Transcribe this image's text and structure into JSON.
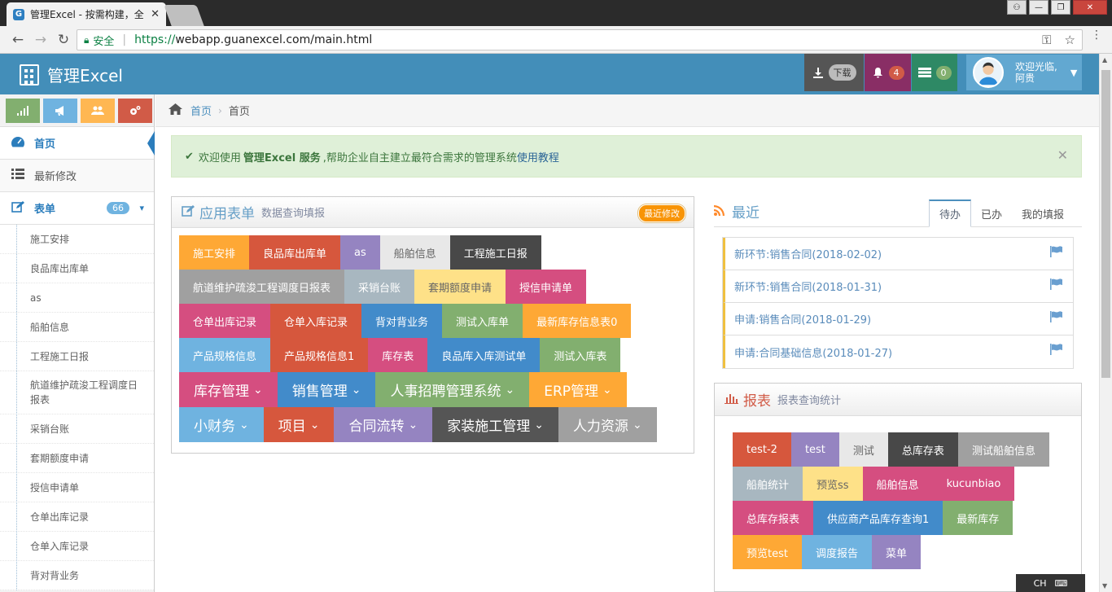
{
  "browser": {
    "tab_title": "管理Excel - 按需构建，全",
    "url_secure": "安全",
    "url_scheme": "https://",
    "url_rest": "webapp.guanexcel.com/main.html"
  },
  "header": {
    "app_name": "管理Excel",
    "download_label": "下载",
    "notifications_count": "4",
    "messages_count": "0",
    "welcome": "欢迎光临,",
    "user_name": "阿贵"
  },
  "sidebar": {
    "nav": [
      {
        "label": "首页"
      },
      {
        "label": "最新修改"
      },
      {
        "label": "表单",
        "count": "66"
      }
    ],
    "submenu": [
      "施工安排",
      "良品库出库单",
      "as",
      "船舶信息",
      "工程施工日报",
      "航道维护疏浚工程调度日报表",
      "采销台账",
      "套期额度申请",
      "授信申请单",
      "仓单出库记录",
      "仓单入库记录",
      "背对背业务"
    ]
  },
  "breadcrumb": {
    "home": "首页",
    "current": "首页"
  },
  "alert": {
    "pre": "欢迎使用",
    "brand": "管理Excel 服务",
    "mid": ",帮助企业自主建立最符合需求的管理系统",
    "link": "使用教程"
  },
  "apps": {
    "title": "应用表单",
    "subtitle": "数据查询填报",
    "badge": "最近修改",
    "tiles": [
      {
        "label": "施工安排",
        "color": "#fea835"
      },
      {
        "label": "良品库出库单",
        "color": "#d6573d"
      },
      {
        "label": "as",
        "color": "#9584c1"
      },
      {
        "label": "船舶信息",
        "color": "#e8e8e8"
      },
      {
        "label": "工程施工日报",
        "color": "#484848"
      },
      {
        "label": "航道维护疏浚工程调度日报表",
        "color": "#a0a0a0"
      },
      {
        "label": "采销台账",
        "color": "#a8b7c0"
      },
      {
        "label": "套期额度申请",
        "color": "#fee188"
      },
      {
        "label": "授信申请单",
        "color": "#d54e80"
      },
      {
        "label": "仓单出库记录",
        "color": "#d54e80"
      },
      {
        "label": "仓单入库记录",
        "color": "#d6573d"
      },
      {
        "label": "背对背业务",
        "color": "#428bca"
      },
      {
        "label": "测试入库单",
        "color": "#82af6f"
      },
      {
        "label": "最新库存信息表0",
        "color": "#fea835"
      },
      {
        "label": "产品规格信息",
        "color": "#6fb3e0"
      },
      {
        "label": "产品规格信息1",
        "color": "#d6573d"
      },
      {
        "label": "库存表",
        "color": "#d54e80"
      },
      {
        "label": "良品库入库测试单",
        "color": "#428bca"
      },
      {
        "label": "测试入库表",
        "color": "#82af6f"
      }
    ],
    "groups": [
      {
        "label": "库存管理",
        "color": "#d54e80"
      },
      {
        "label": "销售管理",
        "color": "#428bca"
      },
      {
        "label": "人事招聘管理系统",
        "color": "#82af6f"
      },
      {
        "label": "ERP管理",
        "color": "#fea835"
      },
      {
        "label": "小财务",
        "color": "#6fb3e0"
      },
      {
        "label": "项目",
        "color": "#d6573d"
      },
      {
        "label": "合同流转",
        "color": "#9584c1"
      },
      {
        "label": "家装施工管理",
        "color": "#555555"
      },
      {
        "label": "人力资源",
        "color": "#a0a0a0"
      }
    ]
  },
  "recent": {
    "title": "最近",
    "tabs": [
      "待办",
      "已办",
      "我的填报"
    ],
    "items": [
      "新环节:销售合同(2018-02-02)",
      "新环节:销售合同(2018-01-31)",
      "申请:销售合同(2018-01-29)",
      "申请:合同基础信息(2018-01-27)"
    ]
  },
  "reports": {
    "title": "报表",
    "subtitle": "报表查询统计",
    "tiles": [
      {
        "label": "test-2",
        "color": "#d6573d"
      },
      {
        "label": "test",
        "color": "#9584c1"
      },
      {
        "label": "测试",
        "color": "#e8e8e8"
      },
      {
        "label": "总库存表",
        "color": "#484848"
      },
      {
        "label": "测试船舶信息",
        "color": "#a0a0a0"
      },
      {
        "label": "船舶统计",
        "color": "#a8b7c0"
      },
      {
        "label": "预览ss",
        "color": "#fee188"
      },
      {
        "label": "船舶信息",
        "color": "#d54e80"
      },
      {
        "label": "kucunbiao",
        "color": "#d54e80"
      },
      {
        "label": "总库存报表",
        "color": "#d54e80"
      },
      {
        "label": "供应商产品库存查询1",
        "color": "#428bca"
      },
      {
        "label": "最新库存",
        "color": "#82af6f"
      },
      {
        "label": "预览test",
        "color": "#fea835"
      },
      {
        "label": "调度报告",
        "color": "#6fb3e0"
      },
      {
        "label": "菜单",
        "color": "#9584c1"
      }
    ]
  },
  "ime": {
    "label": "CH"
  }
}
